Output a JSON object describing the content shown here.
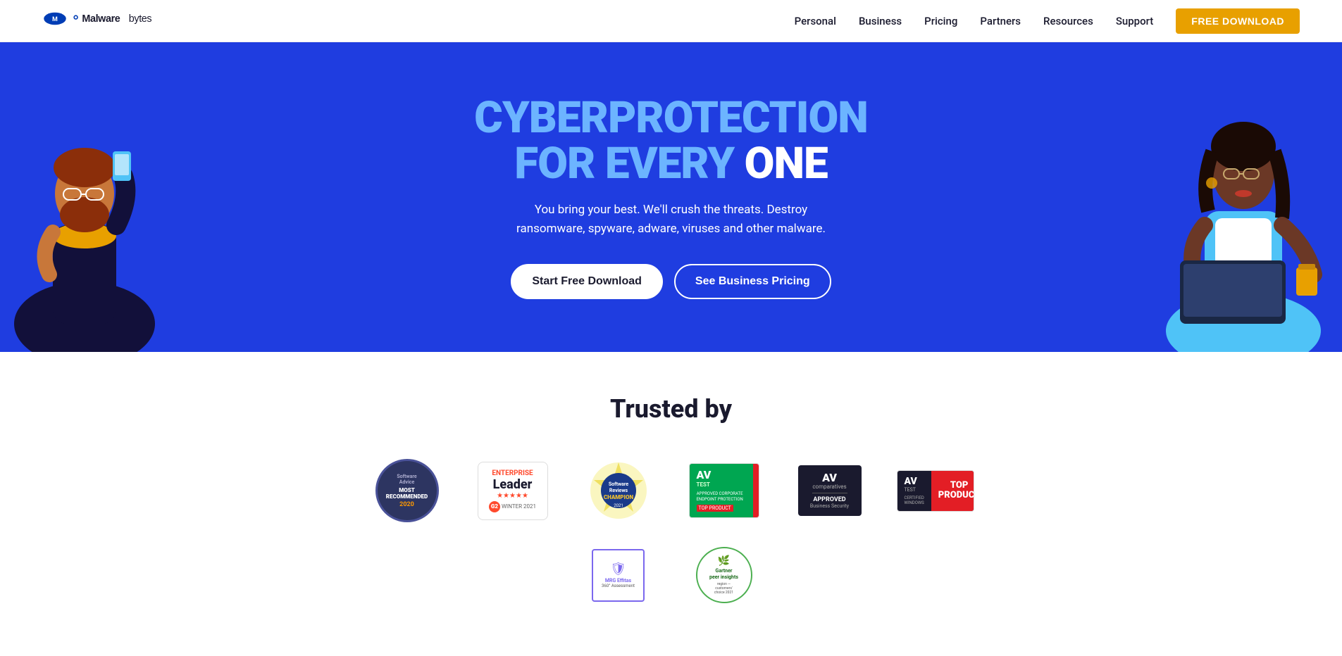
{
  "navbar": {
    "logo_brand": "Malware",
    "logo_brand2": "bytes",
    "nav_items": [
      {
        "label": "Personal",
        "id": "personal"
      },
      {
        "label": "Business",
        "id": "business"
      },
      {
        "label": "Pricing",
        "id": "pricing"
      },
      {
        "label": "Partners",
        "id": "partners"
      },
      {
        "label": "Resources",
        "id": "resources"
      },
      {
        "label": "Support",
        "id": "support"
      }
    ],
    "cta_label": "FREE DOWNLOAD"
  },
  "hero": {
    "title_line1": "CYBERPROTECTION",
    "title_line2": "FOR EVERY",
    "title_line2_highlight": "ONE",
    "subtitle": "You bring your best. We'll crush the threats. Destroy ransomware, spyware, adware, viruses and other malware.",
    "btn_download": "Start Free Download",
    "btn_pricing": "See Business Pricing"
  },
  "trusted": {
    "title": "Trusted by",
    "badges": [
      {
        "id": "software-advice",
        "line1": "Software",
        "line2": "Advice",
        "line3": "MOST",
        "line4": "RECOMMENDED",
        "line5": "2020"
      },
      {
        "id": "g2",
        "label": "ENTERPRISE",
        "leader": "Leader",
        "period": "WINTER 2021",
        "stars": "★★★★★"
      },
      {
        "id": "software-reviews",
        "label": "Software Reviews Champion 2021"
      },
      {
        "id": "av-test-green",
        "line1": "AV",
        "line2": "TEST",
        "line3": "APPROVED CORPORATE ENDPOINT PROTECTION",
        "line4": "TOP PRODUCT"
      },
      {
        "id": "av-comparatives",
        "line1": "AV",
        "line2": "comparatives",
        "line3": "APPROVED",
        "line4": "Business Security"
      },
      {
        "id": "av-test-top",
        "line1": "AV",
        "line2": "TEST",
        "line3": "TOP PRODUCT",
        "line4": "CERTIFIED WINDOWS"
      }
    ],
    "badges_row2": [
      {
        "id": "mrg",
        "line1": "MRG Effitas",
        "line2": "360° Assessment"
      },
      {
        "id": "gartner",
        "line1": "Gartner",
        "line2": "peer insights",
        "line3": "region — customers' choice 2021"
      }
    ]
  }
}
